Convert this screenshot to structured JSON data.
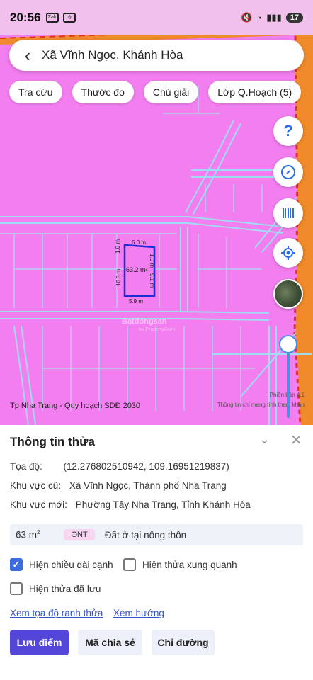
{
  "status": {
    "time": "20:56",
    "battery": "17"
  },
  "search": {
    "text": "Xã Vĩnh Ngọc, Khánh Hòa"
  },
  "chips": [
    "Tra cứu",
    "Thước đo",
    "Chú giải",
    "Lớp Q.Hoạch (5)"
  ],
  "map": {
    "parcel_area": "63.2 m²",
    "dim_top": "6.0 m",
    "dim_bottom": "5.9 m",
    "dim_left_top": "1.0 m",
    "dim_left": "10.3 m",
    "dim_right_top": "1.0 m",
    "dim_right": "9.1 m",
    "watermark": "Batdongsan",
    "watermark_sub": "by PropertyGuru",
    "bottom_left_label": "Tp Nha Trang - Quy hoạch SDĐ 2030",
    "version": "Phiên bản 4.1",
    "note": "Thông tin chỉ mang tính tham khảo",
    "fabs": [
      "help-icon",
      "compass-icon",
      "barcode-icon",
      "locate-icon"
    ]
  },
  "panel": {
    "title": "Thông tin thửa",
    "coord_label": "Tọa độ:",
    "coord_value": "(12.276802510942, 109.16951219837)",
    "old_area_label": "Khu vực cũ:",
    "old_area_value": "Xã Vĩnh Ngọc, Thành phố Nha Trang",
    "new_area_label": "Khu vực mới:",
    "new_area_value": "Phường Tây Nha Trang, Tỉnh Khánh Hòa",
    "area_value": "63 m",
    "area_unit_sup": "2",
    "land_code": "ONT",
    "land_desc": "Đất ở tại nông thôn",
    "checks": [
      {
        "label": "Hiện chiều dài cạnh",
        "checked": true
      },
      {
        "label": "Hiện thửa xung quanh",
        "checked": false
      },
      {
        "label": "Hiện thửa đã lưu",
        "checked": false
      }
    ],
    "links": [
      "Xem tọa độ ranh thửa",
      "Xem hướng"
    ],
    "buttons": [
      "Lưu điểm",
      "Mã chia sẻ",
      "Chỉ đường"
    ]
  }
}
